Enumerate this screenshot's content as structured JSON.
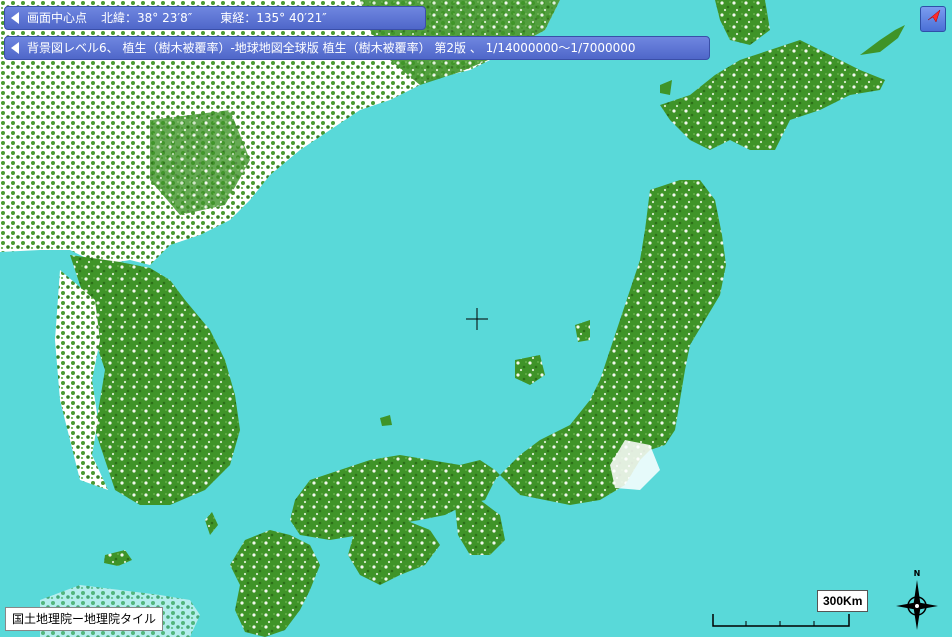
{
  "center_bar": {
    "label": "画面中心点",
    "lat_label": "北緯：",
    "lat_value": "38° 23′8″",
    "lon_label": "東経：",
    "lon_value": "135° 40′21″"
  },
  "layer_bar": {
    "text": "背景図レベル6、 植生（樹木被覆率）-地球地図全球版 植生（樹木被覆率） 第2版 、 1/14000000～1/7000000"
  },
  "attribution": "国土地理院ー地理院タイル",
  "scale": {
    "label": "300Km"
  },
  "compass": {
    "north_label": "N"
  },
  "colors": {
    "sea": "#59d9d9",
    "forest": "#3a8f24",
    "land": "#ffffff"
  }
}
